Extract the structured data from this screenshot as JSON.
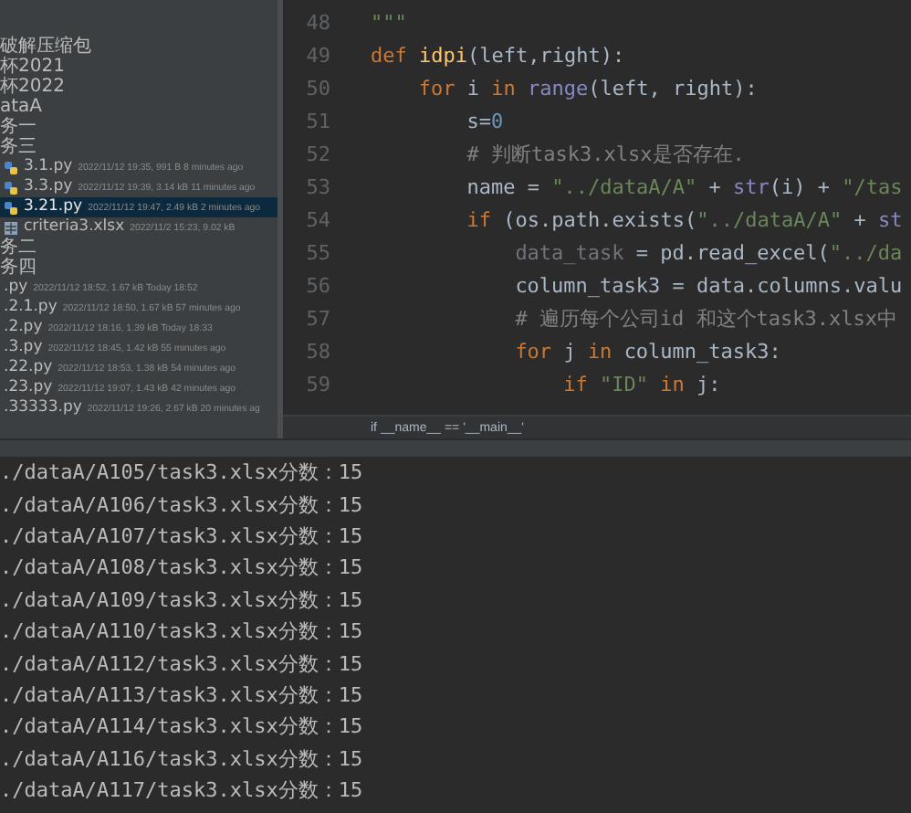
{
  "project_tree": {
    "items": [
      {
        "kind": "folder",
        "label": "破解压缩包",
        "selected": false
      },
      {
        "kind": "folder",
        "label": "杯2021",
        "selected": false
      },
      {
        "kind": "folder",
        "label": "杯2022",
        "selected": false
      },
      {
        "kind": "folder",
        "label": "ataA",
        "selected": false
      },
      {
        "kind": "folder",
        "label": "务一",
        "selected": false
      },
      {
        "kind": "folder",
        "label": "务三",
        "selected": false
      },
      {
        "kind": "python",
        "label": "3.1.py",
        "meta": "2022/11/12 19:35, 991 B 8 minutes ago",
        "selected": false
      },
      {
        "kind": "python",
        "label": "3.3.py",
        "meta": "2022/11/12 19:39, 3.14 kB 11 minutes ago",
        "selected": false
      },
      {
        "kind": "python",
        "label": "3.21.py",
        "meta": "2022/11/12 19:47, 2.49 kB 2 minutes ago",
        "selected": true
      },
      {
        "kind": "sheet",
        "label": "criteria3.xlsx",
        "meta": "2022/11/2 15:23, 9.02 kB",
        "selected": false
      },
      {
        "kind": "folder",
        "label": "务二",
        "selected": false
      },
      {
        "kind": "folder",
        "label": "务四",
        "selected": false
      },
      {
        "kind": "plain",
        "label": ".py",
        "meta": "2022/11/12 18:52, 1.67 kB Today 18:52",
        "selected": false
      },
      {
        "kind": "plain",
        "label": ".2.1.py",
        "meta": "2022/11/12 18:50, 1.67 kB 57 minutes ago",
        "selected": false
      },
      {
        "kind": "plain",
        "label": ".2.py",
        "meta": "2022/11/12 18:16, 1.39 kB Today 18:33",
        "selected": false
      },
      {
        "kind": "plain",
        "label": ".3.py",
        "meta": "2022/11/12 18:45, 1.42 kB 55 minutes ago",
        "selected": false
      },
      {
        "kind": "plain",
        "label": ".22.py",
        "meta": "2022/11/12 18:53, 1.38 kB 54 minutes ago",
        "selected": false
      },
      {
        "kind": "plain",
        "label": ".23.py",
        "meta": "2022/11/12 19:07, 1.43 kB 42 minutes ago",
        "selected": false
      },
      {
        "kind": "plain",
        "label": ".33333.py",
        "meta": "2022/11/12 19:26, 2.67 kB 20 minutes ag",
        "selected": false
      }
    ]
  },
  "editor": {
    "lines": [
      {
        "number": "48",
        "tokens": [
          {
            "kind": "string",
            "text": "\"\"\""
          }
        ]
      },
      {
        "number": "49",
        "tokens": [
          {
            "kind": "keyword",
            "text": "def "
          },
          {
            "kind": "function",
            "text": "idpi"
          },
          {
            "kind": "plain",
            "text": "(left,right):"
          }
        ],
        "children": [
          {
            "number": "50",
            "tokens": [
              {
                "kind": "keyword",
                "text": "for "
              },
              {
                "kind": "plain",
                "text": "i "
              },
              {
                "kind": "keyword",
                "text": "in "
              },
              {
                "kind": "builtin",
                "text": "range"
              },
              {
                "kind": "plain",
                "text": "(left, right):"
              }
            ],
            "children": [
              {
                "number": "51",
                "tokens": [
                  {
                    "kind": "plain",
                    "text": "s="
                  },
                  {
                    "kind": "number",
                    "text": "0"
                  }
                ]
              },
              {
                "number": "52",
                "tokens": [
                  {
                    "kind": "comment",
                    "text": "# 判断task3.xlsx是否存在."
                  }
                ]
              },
              {
                "number": "53",
                "tokens": [
                  {
                    "kind": "plain",
                    "text": "name = "
                  },
                  {
                    "kind": "string",
                    "text": "\"../dataA/A\""
                  },
                  {
                    "kind": "plain",
                    "text": " + "
                  },
                  {
                    "kind": "builtin",
                    "text": "str"
                  },
                  {
                    "kind": "plain",
                    "text": "(i) + "
                  },
                  {
                    "kind": "string",
                    "text": "\"/tas"
                  }
                ]
              },
              {
                "number": "54",
                "tokens": [
                  {
                    "kind": "keyword",
                    "text": "if "
                  },
                  {
                    "kind": "plain",
                    "text": "(os.path.exists("
                  },
                  {
                    "kind": "string",
                    "text": "\"../dataA/A\""
                  },
                  {
                    "kind": "plain",
                    "text": " + "
                  },
                  {
                    "kind": "builtin",
                    "text": "st"
                  }
                ],
                "children": [
                  {
                    "number": "55",
                    "tokens": [
                      {
                        "kind": "unused",
                        "text": "data_task"
                      },
                      {
                        "kind": "plain",
                        "text": " = pd.read_excel("
                      },
                      {
                        "kind": "string",
                        "text": "\"../da"
                      }
                    ]
                  },
                  {
                    "number": "56",
                    "tokens": [
                      {
                        "kind": "plain",
                        "text": "column_task3 = data.columns.valu"
                      }
                    ]
                  },
                  {
                    "number": "57",
                    "tokens": [
                      {
                        "kind": "comment",
                        "text": "# 遍历每个公司id 和这个task3.xlsx中"
                      }
                    ]
                  },
                  {
                    "number": "58",
                    "tokens": [
                      {
                        "kind": "keyword",
                        "text": "for "
                      },
                      {
                        "kind": "plain",
                        "text": "j "
                      },
                      {
                        "kind": "keyword",
                        "text": "in "
                      },
                      {
                        "kind": "plain",
                        "text": "column_task3:"
                      }
                    ],
                    "children": [
                      {
                        "number": "59",
                        "tokens": [
                          {
                            "kind": "keyword",
                            "text": "if "
                          },
                          {
                            "kind": "string",
                            "text": "\"ID\""
                          },
                          {
                            "kind": "keyword",
                            "text": " in "
                          },
                          {
                            "kind": "plain",
                            "text": "j:"
                          }
                        ]
                      }
                    ]
                  }
                ]
              }
            ]
          }
        ]
      }
    ],
    "breadcrumb": "if __name__ == '__main__'"
  },
  "console": {
    "lines": [
      "./dataA/A105/task3.xlsx分数：15",
      "./dataA/A106/task3.xlsx分数：15",
      "./dataA/A107/task3.xlsx分数：15",
      "./dataA/A108/task3.xlsx分数：15",
      "./dataA/A109/task3.xlsx分数：15",
      "./dataA/A110/task3.xlsx分数：15",
      "./dataA/A112/task3.xlsx分数：15",
      "./dataA/A113/task3.xlsx分数：15",
      "./dataA/A114/task3.xlsx分数：15",
      "./dataA/A116/task3.xlsx分数：15",
      "./dataA/A117/task3.xlsx分数：15"
    ]
  }
}
